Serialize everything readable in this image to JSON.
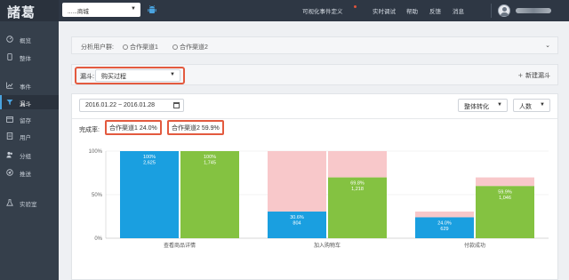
{
  "app": {
    "logo": "諸葛",
    "project": "......商城"
  },
  "top_nav": {
    "links": [
      "可视化事件定义",
      "实时调试",
      "帮助",
      "反馈",
      "消息"
    ]
  },
  "sidebar": {
    "items": [
      {
        "label": "概览",
        "icon": "gauge-icon"
      },
      {
        "label": "整体",
        "icon": "phone-icon"
      },
      {
        "label": "事件",
        "icon": "chart-line-icon"
      },
      {
        "label": "漏斗",
        "icon": "funnel-icon"
      },
      {
        "label": "留存",
        "icon": "calendar-icon"
      },
      {
        "label": "用户",
        "icon": "document-icon"
      },
      {
        "label": "分组",
        "icon": "users-icon"
      },
      {
        "label": "推送",
        "icon": "send-icon"
      },
      {
        "label": "实验室",
        "icon": "flask-icon"
      }
    ],
    "active_index": 3
  },
  "filter": {
    "label": "分析用户群:",
    "chips": [
      "合作渠道1",
      "合作渠道2"
    ]
  },
  "funnel": {
    "label": "漏斗:",
    "selected": "购买过程",
    "new_label": "新建漏斗"
  },
  "controls": {
    "date_range": "2016.01.22 ~ 2016.01.28",
    "conversion_mode": "整体转化",
    "metric": "人数"
  },
  "completion": {
    "label": "完成率:",
    "rates": [
      "合作渠道1  24.0%",
      "合作渠道2  59.9%"
    ]
  },
  "colors": {
    "series1": "#1a9fe0",
    "series2": "#84c241",
    "dropoff": "#f8c8ca",
    "highlight": "#e35a3f"
  },
  "chart_data": {
    "type": "bar",
    "categories": [
      "查看商品详情",
      "加入购物车",
      "付款成功"
    ],
    "ylim": [
      0,
      100
    ],
    "yticks": [
      "0%",
      "50%",
      "100%"
    ],
    "series": [
      {
        "name": "合作渠道1",
        "percents": [
          100,
          30.6,
          24.0
        ],
        "percent_labels": [
          "100%",
          "30.6%",
          "24.0%"
        ],
        "counts": [
          "2,625",
          "804",
          "629"
        ]
      },
      {
        "name": "合作渠道2",
        "percents": [
          100,
          69.8,
          59.9
        ],
        "percent_labels": [
          "100%",
          "69.8%",
          "59.9%"
        ],
        "counts": [
          "1,745",
          "1,218",
          "1,046"
        ]
      }
    ]
  }
}
